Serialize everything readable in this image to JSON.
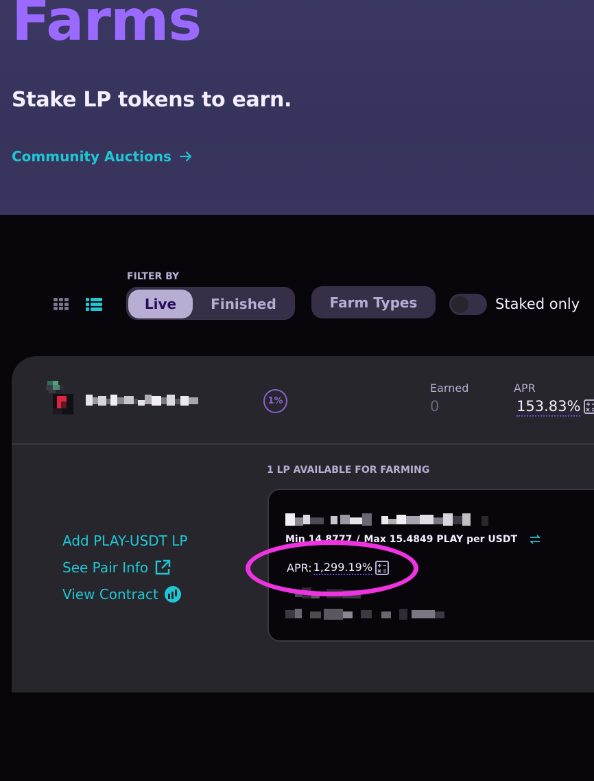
{
  "hero": {
    "title": "Farms",
    "subtitle": "Stake LP tokens to earn.",
    "link_label": "Community Auctions"
  },
  "toolbar": {
    "filter_label": "FILTER BY",
    "live_label": "Live",
    "finished_label": "Finished",
    "farm_types_label": "Farm Types",
    "staked_only_label": "Staked only",
    "active_view": "list",
    "staked_only": false
  },
  "farm": {
    "multiplier": "1%",
    "earned_label": "Earned",
    "earned_value": "0",
    "apr_label": "APR",
    "apr_value": "153.83%",
    "links": {
      "add_lp": "Add PLAY-USDT LP",
      "pair_info": "See Pair Info",
      "contract": "View Contract"
    },
    "lp_available": "1 LP AVAILABLE FOR FARMING",
    "position": {
      "range_min": "Min 14.8777",
      "range_sep": "/",
      "range_max": "Max 15.4849 PLAY per USDT",
      "apr_label": "APR:",
      "apr_value": "1,299.19%"
    }
  },
  "colors": {
    "accent_purple": "#9a6aff",
    "accent_cyan": "#1fc7d4",
    "annotation_magenta": "#ee34e1"
  }
}
